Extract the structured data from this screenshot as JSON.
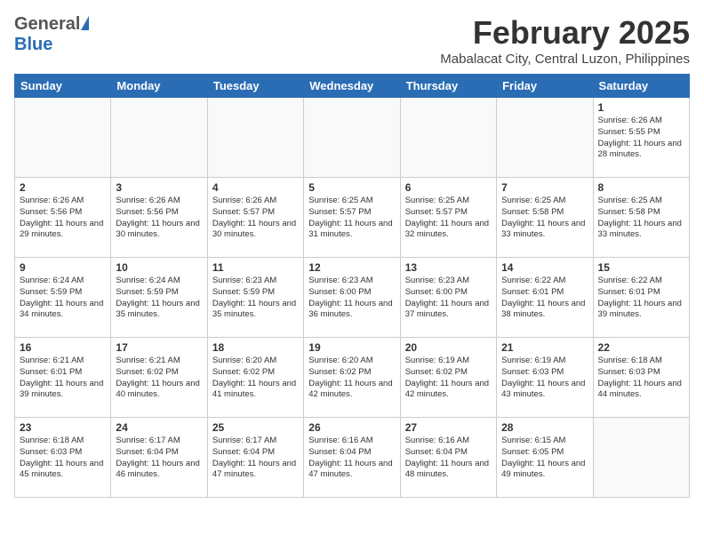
{
  "header": {
    "logo_general": "General",
    "logo_blue": "Blue",
    "month_title": "February 2025",
    "subtitle": "Mabalacat City, Central Luzon, Philippines"
  },
  "days_of_week": [
    "Sunday",
    "Monday",
    "Tuesday",
    "Wednesday",
    "Thursday",
    "Friday",
    "Saturday"
  ],
  "weeks": [
    [
      {
        "day": "",
        "info": ""
      },
      {
        "day": "",
        "info": ""
      },
      {
        "day": "",
        "info": ""
      },
      {
        "day": "",
        "info": ""
      },
      {
        "day": "",
        "info": ""
      },
      {
        "day": "",
        "info": ""
      },
      {
        "day": "1",
        "info": "Sunrise: 6:26 AM\nSunset: 5:55 PM\nDaylight: 11 hours and 28 minutes."
      }
    ],
    [
      {
        "day": "2",
        "info": "Sunrise: 6:26 AM\nSunset: 5:56 PM\nDaylight: 11 hours and 29 minutes."
      },
      {
        "day": "3",
        "info": "Sunrise: 6:26 AM\nSunset: 5:56 PM\nDaylight: 11 hours and 30 minutes."
      },
      {
        "day": "4",
        "info": "Sunrise: 6:26 AM\nSunset: 5:57 PM\nDaylight: 11 hours and 30 minutes."
      },
      {
        "day": "5",
        "info": "Sunrise: 6:25 AM\nSunset: 5:57 PM\nDaylight: 11 hours and 31 minutes."
      },
      {
        "day": "6",
        "info": "Sunrise: 6:25 AM\nSunset: 5:57 PM\nDaylight: 11 hours and 32 minutes."
      },
      {
        "day": "7",
        "info": "Sunrise: 6:25 AM\nSunset: 5:58 PM\nDaylight: 11 hours and 33 minutes."
      },
      {
        "day": "8",
        "info": "Sunrise: 6:25 AM\nSunset: 5:58 PM\nDaylight: 11 hours and 33 minutes."
      }
    ],
    [
      {
        "day": "9",
        "info": "Sunrise: 6:24 AM\nSunset: 5:59 PM\nDaylight: 11 hours and 34 minutes."
      },
      {
        "day": "10",
        "info": "Sunrise: 6:24 AM\nSunset: 5:59 PM\nDaylight: 11 hours and 35 minutes."
      },
      {
        "day": "11",
        "info": "Sunrise: 6:23 AM\nSunset: 5:59 PM\nDaylight: 11 hours and 35 minutes."
      },
      {
        "day": "12",
        "info": "Sunrise: 6:23 AM\nSunset: 6:00 PM\nDaylight: 11 hours and 36 minutes."
      },
      {
        "day": "13",
        "info": "Sunrise: 6:23 AM\nSunset: 6:00 PM\nDaylight: 11 hours and 37 minutes."
      },
      {
        "day": "14",
        "info": "Sunrise: 6:22 AM\nSunset: 6:01 PM\nDaylight: 11 hours and 38 minutes."
      },
      {
        "day": "15",
        "info": "Sunrise: 6:22 AM\nSunset: 6:01 PM\nDaylight: 11 hours and 39 minutes."
      }
    ],
    [
      {
        "day": "16",
        "info": "Sunrise: 6:21 AM\nSunset: 6:01 PM\nDaylight: 11 hours and 39 minutes."
      },
      {
        "day": "17",
        "info": "Sunrise: 6:21 AM\nSunset: 6:02 PM\nDaylight: 11 hours and 40 minutes."
      },
      {
        "day": "18",
        "info": "Sunrise: 6:20 AM\nSunset: 6:02 PM\nDaylight: 11 hours and 41 minutes."
      },
      {
        "day": "19",
        "info": "Sunrise: 6:20 AM\nSunset: 6:02 PM\nDaylight: 11 hours and 42 minutes."
      },
      {
        "day": "20",
        "info": "Sunrise: 6:19 AM\nSunset: 6:02 PM\nDaylight: 11 hours and 42 minutes."
      },
      {
        "day": "21",
        "info": "Sunrise: 6:19 AM\nSunset: 6:03 PM\nDaylight: 11 hours and 43 minutes."
      },
      {
        "day": "22",
        "info": "Sunrise: 6:18 AM\nSunset: 6:03 PM\nDaylight: 11 hours and 44 minutes."
      }
    ],
    [
      {
        "day": "23",
        "info": "Sunrise: 6:18 AM\nSunset: 6:03 PM\nDaylight: 11 hours and 45 minutes."
      },
      {
        "day": "24",
        "info": "Sunrise: 6:17 AM\nSunset: 6:04 PM\nDaylight: 11 hours and 46 minutes."
      },
      {
        "day": "25",
        "info": "Sunrise: 6:17 AM\nSunset: 6:04 PM\nDaylight: 11 hours and 47 minutes."
      },
      {
        "day": "26",
        "info": "Sunrise: 6:16 AM\nSunset: 6:04 PM\nDaylight: 11 hours and 47 minutes."
      },
      {
        "day": "27",
        "info": "Sunrise: 6:16 AM\nSunset: 6:04 PM\nDaylight: 11 hours and 48 minutes."
      },
      {
        "day": "28",
        "info": "Sunrise: 6:15 AM\nSunset: 6:05 PM\nDaylight: 11 hours and 49 minutes."
      },
      {
        "day": "",
        "info": ""
      }
    ]
  ]
}
